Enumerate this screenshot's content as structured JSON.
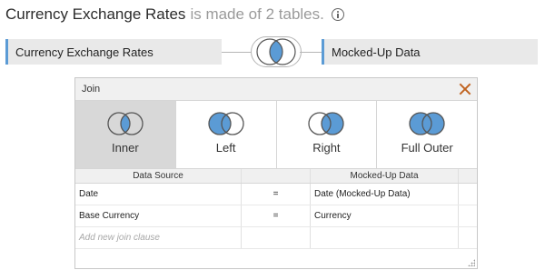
{
  "header": {
    "source_name": "Currency Exchange Rates",
    "source_suffix": "is made of 2 tables."
  },
  "tables": {
    "left": "Currency Exchange Rates",
    "right": "Mocked-Up Data"
  },
  "join_dialog": {
    "title": "Join",
    "join_types": [
      {
        "label": "Inner",
        "icon": "inner-join-icon",
        "selected": true
      },
      {
        "label": "Left",
        "icon": "left-join-icon",
        "selected": false
      },
      {
        "label": "Right",
        "icon": "right-join-icon",
        "selected": false
      },
      {
        "label": "Full Outer",
        "icon": "full-outer-join-icon",
        "selected": false
      }
    ],
    "columns": {
      "left": "Data Source",
      "right": "Mocked-Up Data"
    },
    "clauses": [
      {
        "left": "Date",
        "op": "=",
        "right": "Date (Mocked-Up Data)"
      },
      {
        "left": "Base Currency",
        "op": "=",
        "right": "Currency"
      }
    ],
    "add_placeholder": "Add new join clause"
  },
  "colors": {
    "accent_blue": "#5b9bd5",
    "close_orange": "#c0631f",
    "selected_bg": "#d8d8d8"
  }
}
